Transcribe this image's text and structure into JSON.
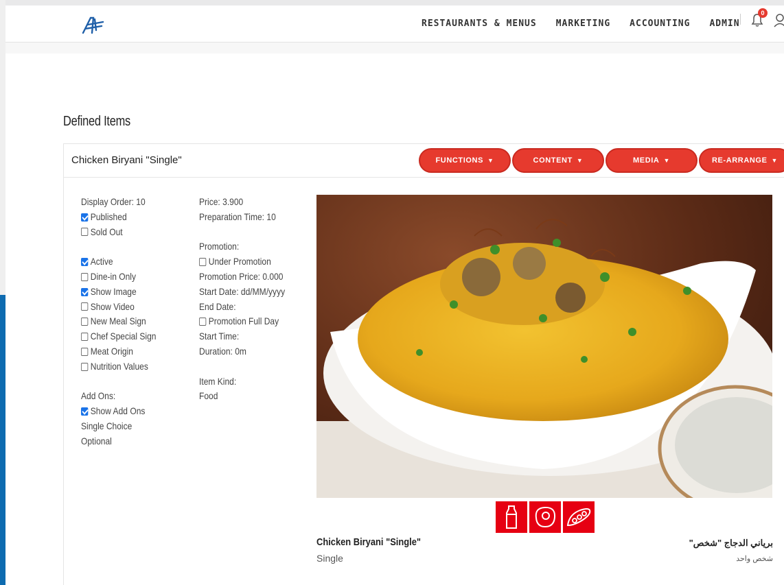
{
  "nav": {
    "items": [
      "RESTAURANTS & MENUS",
      "MARKETING",
      "ACCOUNTING",
      "ADMIN"
    ],
    "notification_count": "0"
  },
  "section": {
    "title": "Defined Items"
  },
  "item": {
    "title": "Chicken Biryani \"Single\"",
    "buttons": [
      "FUNCTIONS",
      "CONTENT",
      "MEDIA",
      "RE-ARRANGE"
    ],
    "col1": [
      {
        "type": "text",
        "label": "Display Order: 10"
      },
      {
        "type": "check",
        "label": "Published",
        "checked": true
      },
      {
        "type": "check",
        "label": "Sold Out",
        "checked": false
      },
      {
        "type": "gap"
      },
      {
        "type": "check",
        "label": "Active",
        "checked": true
      },
      {
        "type": "check",
        "label": "Dine-in Only",
        "checked": false
      },
      {
        "type": "check",
        "label": "Show Image",
        "checked": true
      },
      {
        "type": "check",
        "label": "Show Video",
        "checked": false
      },
      {
        "type": "check",
        "label": "New Meal Sign",
        "checked": false
      },
      {
        "type": "check",
        "label": "Chef Special Sign",
        "checked": false
      },
      {
        "type": "check",
        "label": "Meat Origin",
        "checked": false
      },
      {
        "type": "check",
        "label": "Nutrition Values",
        "checked": false
      },
      {
        "type": "gap"
      },
      {
        "type": "text",
        "label": "Add Ons:"
      },
      {
        "type": "check",
        "label": "Show Add Ons",
        "checked": true
      },
      {
        "type": "text",
        "label": "Single Choice"
      },
      {
        "type": "text",
        "label": "Optional"
      }
    ],
    "col2": [
      {
        "type": "text",
        "label": "Price: 3.900"
      },
      {
        "type": "text",
        "label": "Preparation Time: 10"
      },
      {
        "type": "gap"
      },
      {
        "type": "text",
        "label": "Promotion:"
      },
      {
        "type": "check",
        "label": "Under Promotion",
        "checked": false
      },
      {
        "type": "text",
        "label": "Promotion Price: 0.000"
      },
      {
        "type": "text",
        "label": "Start Date: dd/MM/yyyy"
      },
      {
        "type": "text",
        "label": "End Date:"
      },
      {
        "type": "check",
        "label": "Promotion Full Day",
        "checked": false
      },
      {
        "type": "text",
        "label": "Start Time:"
      },
      {
        "type": "text",
        "label": "Duration: 0m"
      },
      {
        "type": "gap"
      },
      {
        "type": "text",
        "label": "Item Kind:"
      },
      {
        "type": "text",
        "label": "Food"
      }
    ],
    "allergen_icons": [
      "milk-icon",
      "egg-icon",
      "soy-icon"
    ],
    "name_en": "Chicken Biryani \"Single\"",
    "desc_en": "Single",
    "name_ar": "برياني الدجاج \"شخص\"",
    "desc_ar": "شخص واحد"
  },
  "colors": {
    "accent": "#e63a2e",
    "allergen": "#e60012",
    "checkbox": "#1a73e8",
    "sidebar": "#0e6bb0"
  }
}
